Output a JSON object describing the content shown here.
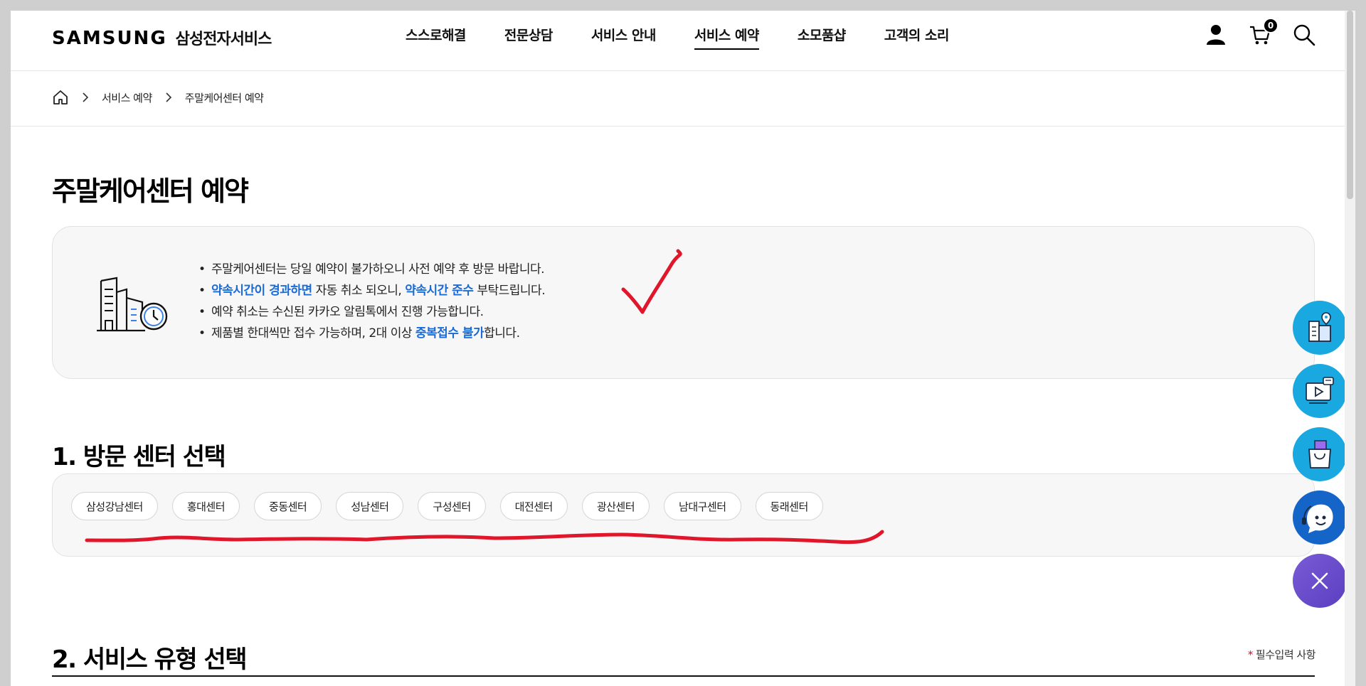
{
  "header": {
    "logo_text": "SAMSUNG",
    "logo_sub": "삼성전자서비스",
    "nav": [
      {
        "label": "스스로해결"
      },
      {
        "label": "전문상담"
      },
      {
        "label": "서비스 안내"
      },
      {
        "label": "서비스 예약",
        "active": true
      },
      {
        "label": "소모품샵"
      },
      {
        "label": "고객의 소리"
      }
    ],
    "cart_count": "0"
  },
  "breadcrumb": {
    "items": [
      "서비스 예약",
      "주말케어센터 예약"
    ]
  },
  "page_title": "주말케어센터 예약",
  "notice": {
    "line1": "주말케어센터는 당일 예약이 불가하오니 사전 예약 후 방문 바랍니다.",
    "line2_hl1": "약속시간이 경과하면",
    "line2_mid": " 자동 취소 되오니, ",
    "line2_hl2": "약속시간 준수",
    "line2_end": " 부탁드립니다.",
    "line3": "예약 취소는 수신된 카카오 알림톡에서 진행 가능합니다.",
    "line4_start": "제품별 한대씩만 접수 가능하며, 2대 이상 ",
    "line4_hl": "중복접수 불가",
    "line4_end": "합니다."
  },
  "section1": {
    "title": "1. 방문 센터 선택",
    "centers": [
      "삼성강남센터",
      "홍대센터",
      "중동센터",
      "성남센터",
      "구성센터",
      "대전센터",
      "광산센터",
      "남대구센터",
      "동래센터"
    ]
  },
  "section2": {
    "title": "2. 서비스 유형 선택",
    "required_star": "*",
    "required_text": "필수입력 사항"
  },
  "colors": {
    "highlight_blue": "#1a6bd6",
    "annotation_red": "#e0162b",
    "float_cyan": "#1aa8e0",
    "float_purple": "#7a5bd6"
  }
}
